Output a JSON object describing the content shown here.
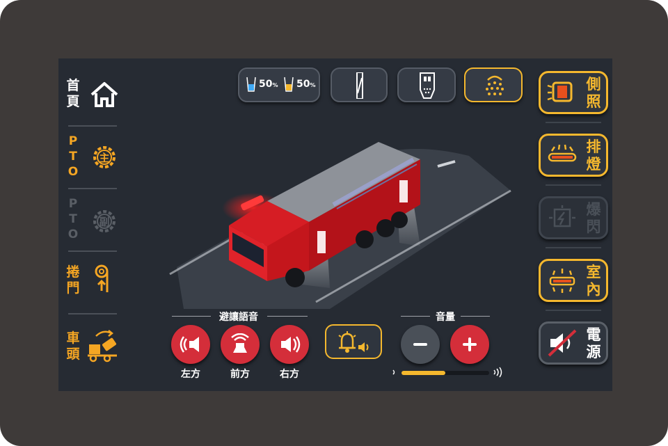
{
  "nav": {
    "home": "首\n頁",
    "pto_main": "P\nT\nO",
    "pto_main_badge": "主",
    "pto_sub": "P\nT\nO",
    "pto_sub_badge": "副",
    "roller_door": "捲\n門",
    "cab": "車\n頭"
  },
  "top": {
    "tank1_pct": "50",
    "tank2_pct": "50",
    "pct_sign": "%",
    "tank_levels": [
      0.5,
      0.5
    ]
  },
  "right": {
    "side_light": "側\n照",
    "light_bar": "排\n燈",
    "strobe": "爆\n閃",
    "interior": "室\n內",
    "power": "電\n源"
  },
  "siren": {
    "title": "避讓語音",
    "left": "左方",
    "front": "前方",
    "right": "右方"
  },
  "volume": {
    "title": "音量",
    "level": 0.5
  },
  "colors": {
    "accent": "#f5b82e",
    "red": "#d42e3a",
    "bg": "#262b33"
  }
}
